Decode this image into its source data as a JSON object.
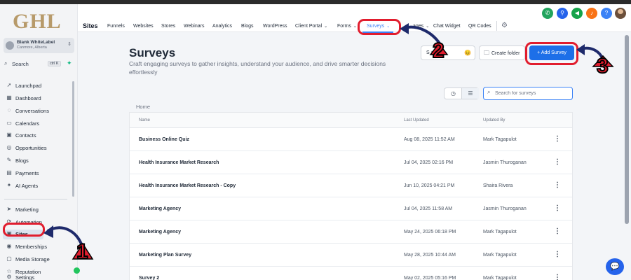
{
  "sidebar": {
    "logo": "GHL",
    "account_name": "Blank WhiteLabel",
    "account_location": "Canmore, Alberta",
    "search_label": "Search",
    "search_shortcut": "ctrl K",
    "items": [
      {
        "label": "Launchpad",
        "icon": "rocket-icon"
      },
      {
        "label": "Dashboard",
        "icon": "grid-icon"
      },
      {
        "label": "Conversations",
        "icon": "chat-icon"
      },
      {
        "label": "Calendars",
        "icon": "calendar-icon"
      },
      {
        "label": "Contacts",
        "icon": "contacts-icon"
      },
      {
        "label": "Opportunities",
        "icon": "target-icon"
      },
      {
        "label": "Blogs",
        "icon": "blog-icon"
      },
      {
        "label": "Payments",
        "icon": "payments-icon"
      },
      {
        "label": "AI Agents",
        "icon": "sparkle-icon"
      },
      {
        "label": "Marketing",
        "icon": "send-icon"
      },
      {
        "label": "Automation",
        "icon": "automation-icon"
      },
      {
        "label": "Sites",
        "icon": "sites-icon"
      },
      {
        "label": "Memberships",
        "icon": "membership-icon"
      },
      {
        "label": "Media Storage",
        "icon": "folder-icon"
      },
      {
        "label": "Reputation",
        "icon": "star-icon"
      },
      {
        "label": "Settings",
        "icon": "gear-icon"
      }
    ]
  },
  "topnav": {
    "title": "Sites",
    "items": [
      "Funnels",
      "Websites",
      "Stores",
      "Webinars",
      "Analytics",
      "Blogs",
      "WordPress",
      "Client Portal",
      "Forms",
      "Surveys",
      "ages",
      "Chat Widget",
      "QR Codes"
    ],
    "active": "Surveys"
  },
  "header_icons": [
    {
      "name": "phone-icon",
      "color": "#22a45d"
    },
    {
      "name": "link-icon",
      "color": "#2563eb"
    },
    {
      "name": "megaphone-icon",
      "color": "#16a34a"
    },
    {
      "name": "bell-icon",
      "color": "#f97316"
    },
    {
      "name": "help-icon",
      "color": "#3b82f6"
    }
  ],
  "main": {
    "title": "Surveys",
    "subtitle": "Craft engaging surveys to gather insights, understand your audience, and drive smarter decisions effortlessly",
    "btn_features": "S        atures",
    "btn_create_folder": "Create folder",
    "btn_add_survey": "+ Add Survey",
    "search_placeholder": "Search for surveys",
    "breadcrumb": "Home",
    "columns": {
      "name": "Name",
      "last_updated": "Last Updated",
      "updated_by": "Updated By"
    },
    "rows": [
      {
        "name": "Business Online Quiz",
        "last_updated": "Aug 08, 2025 11:52 AM",
        "updated_by": "Mark Tagapulot"
      },
      {
        "name": "Health Insurance Market Research",
        "last_updated": "Jul 04, 2025 02:16 PM",
        "updated_by": "Jasmin Thuroganan"
      },
      {
        "name": "Health Insurance Market Research - Copy",
        "last_updated": "Jun 10, 2025 04:21 PM",
        "updated_by": "Shaira Rivera"
      },
      {
        "name": "Marketing Agency",
        "last_updated": "Jul 04, 2025 11:58 AM",
        "updated_by": "Jasmin Thuroganan"
      },
      {
        "name": "Marketing Agency",
        "last_updated": "May 24, 2025 06:18 PM",
        "updated_by": "Mark Tagapulot"
      },
      {
        "name": "Marketing Plan Survey",
        "last_updated": "May 28, 2025 10:44 AM",
        "updated_by": "Mark Tagapulot"
      },
      {
        "name": "Survey 2",
        "last_updated": "May 02, 2025 05:16 PM",
        "updated_by": "Mark Tagapulot"
      }
    ]
  },
  "annotations": {
    "step1": "1",
    "step2": "2",
    "step3": "3",
    "highlight_color": "#e11d2e",
    "arrow_color": "#1e2a6b"
  }
}
